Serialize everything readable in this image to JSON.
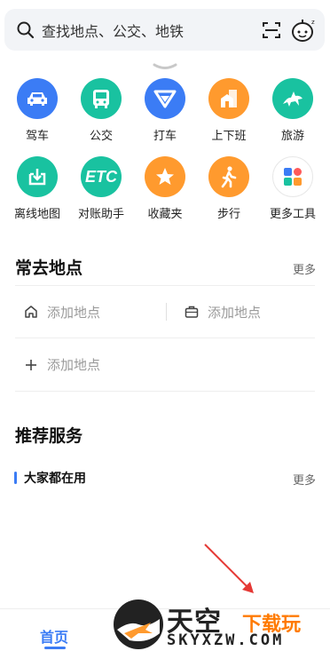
{
  "search": {
    "placeholder": "查找地点、公交、地铁"
  },
  "tools": [
    [
      {
        "label": "驾车",
        "icon": "car-icon",
        "color": "#3b7cf5"
      },
      {
        "label": "公交",
        "icon": "bus-icon",
        "color": "#19c2a0"
      },
      {
        "label": "打车",
        "icon": "taxi-icon",
        "color": "#3b7cf5"
      },
      {
        "label": "上下班",
        "icon": "commute-icon",
        "color": "#ff9a2e"
      },
      {
        "label": "旅游",
        "icon": "travel-icon",
        "color": "#19c2a0"
      }
    ],
    [
      {
        "label": "离线地图",
        "icon": "offline-map-icon",
        "color": "#19c2a0"
      },
      {
        "label": "对账助手",
        "icon": "etc-icon",
        "color": "#19c2a0",
        "text": "ETC"
      },
      {
        "label": "收藏夹",
        "icon": "star-icon",
        "color": "#ff9a2e"
      },
      {
        "label": "步行",
        "icon": "walk-icon",
        "color": "#ff9a2e"
      },
      {
        "label": "更多工具",
        "icon": "more-tools-icon",
        "color": "#ffffff"
      }
    ]
  ],
  "frequent": {
    "title": "常去地点",
    "more": "更多",
    "home_label": "添加地点",
    "work_label": "添加地点",
    "add_label": "添加地点"
  },
  "recommend": {
    "title": "推荐服务",
    "subtitle": "大家都在用",
    "more": "更多"
  },
  "nav": {
    "home": "首页"
  },
  "watermark": {
    "brand": "天空",
    "suffix": "下载玩",
    "domain": "SKYXZW.COM"
  }
}
